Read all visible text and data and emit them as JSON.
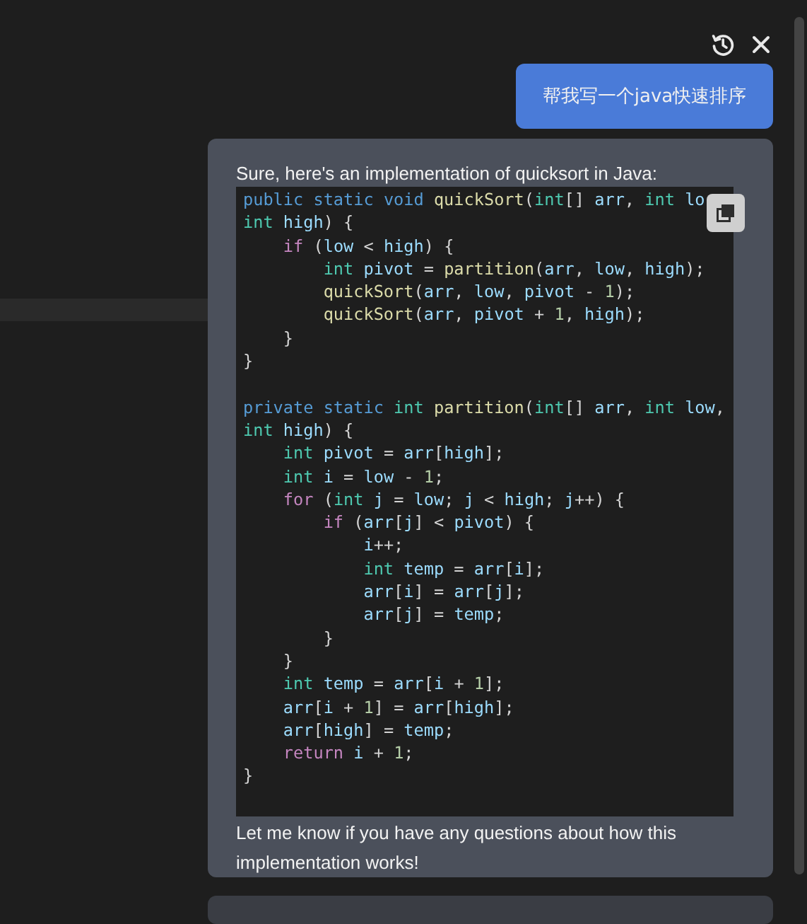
{
  "user_message": {
    "text": "帮我写一个java快速排序"
  },
  "reply": {
    "intro": "Sure, here's an implementation of quicksort in Java:",
    "code_methods": [
      {
        "lines": [
          {
            "tokens": [
              {
                "kind": "kw",
                "text": "public "
              },
              {
                "kind": "kw",
                "text": "static "
              },
              {
                "kind": "kw",
                "text": "void "
              },
              {
                "kind": "fn",
                "text": "quickSort"
              },
              {
                "kind": "p",
                "text": "("
              },
              {
                "kind": "type",
                "text": "int"
              },
              {
                "kind": "p",
                "text": "[] "
              },
              {
                "kind": "var",
                "text": "arr"
              },
              {
                "kind": "p",
                "text": ", "
              },
              {
                "kind": "type",
                "text": "int "
              },
              {
                "kind": "var",
                "text": "lo"
              }
            ]
          },
          {
            "tokens": [
              {
                "kind": "type",
                "text": "int "
              },
              {
                "kind": "var",
                "text": "high"
              },
              {
                "kind": "p",
                "text": ") {"
              }
            ]
          },
          {
            "tokens": [
              {
                "kind": "ctl",
                "text": "    if"
              },
              {
                "kind": "p",
                "text": " ("
              },
              {
                "kind": "var",
                "text": "low"
              },
              {
                "kind": "p",
                "text": " < "
              },
              {
                "kind": "var",
                "text": "high"
              },
              {
                "kind": "p",
                "text": ") {"
              }
            ]
          },
          {
            "tokens": [
              {
                "kind": "type",
                "text": "        int "
              },
              {
                "kind": "var",
                "text": "pivot"
              },
              {
                "kind": "p",
                "text": " = "
              },
              {
                "kind": "fn",
                "text": "partition"
              },
              {
                "kind": "p",
                "text": "("
              },
              {
                "kind": "var",
                "text": "arr"
              },
              {
                "kind": "p",
                "text": ", "
              },
              {
                "kind": "var",
                "text": "low"
              },
              {
                "kind": "p",
                "text": ", "
              },
              {
                "kind": "var",
                "text": "high"
              },
              {
                "kind": "p",
                "text": ");"
              }
            ]
          },
          {
            "tokens": [
              {
                "kind": "fn",
                "text": "        quickSort"
              },
              {
                "kind": "p",
                "text": "("
              },
              {
                "kind": "var",
                "text": "arr"
              },
              {
                "kind": "p",
                "text": ", "
              },
              {
                "kind": "var",
                "text": "low"
              },
              {
                "kind": "p",
                "text": ", "
              },
              {
                "kind": "var",
                "text": "pivot"
              },
              {
                "kind": "p",
                "text": " - "
              },
              {
                "kind": "num",
                "text": "1"
              },
              {
                "kind": "p",
                "text": ");"
              }
            ]
          },
          {
            "tokens": [
              {
                "kind": "fn",
                "text": "        quickSort"
              },
              {
                "kind": "p",
                "text": "("
              },
              {
                "kind": "var",
                "text": "arr"
              },
              {
                "kind": "p",
                "text": ", "
              },
              {
                "kind": "var",
                "text": "pivot"
              },
              {
                "kind": "p",
                "text": " + "
              },
              {
                "kind": "num",
                "text": "1"
              },
              {
                "kind": "p",
                "text": ", "
              },
              {
                "kind": "var",
                "text": "high"
              },
              {
                "kind": "p",
                "text": ");"
              }
            ]
          },
          {
            "tokens": [
              {
                "kind": "p",
                "text": "    }"
              }
            ]
          },
          {
            "tokens": [
              {
                "kind": "p",
                "text": "}"
              }
            ]
          }
        ]
      },
      {
        "lines": [
          {
            "tokens": [
              {
                "kind": "kw",
                "text": "private "
              },
              {
                "kind": "kw",
                "text": "static "
              },
              {
                "kind": "type",
                "text": "int "
              },
              {
                "kind": "fn",
                "text": "partition"
              },
              {
                "kind": "p",
                "text": "("
              },
              {
                "kind": "type",
                "text": "int"
              },
              {
                "kind": "p",
                "text": "[] "
              },
              {
                "kind": "var",
                "text": "arr"
              },
              {
                "kind": "p",
                "text": ", "
              },
              {
                "kind": "type",
                "text": "int "
              },
              {
                "kind": "var",
                "text": "low"
              },
              {
                "kind": "p",
                "text": ","
              }
            ]
          },
          {
            "tokens": [
              {
                "kind": "type",
                "text": "int "
              },
              {
                "kind": "var",
                "text": "high"
              },
              {
                "kind": "p",
                "text": ") {"
              }
            ]
          },
          {
            "tokens": [
              {
                "kind": "type",
                "text": "    int "
              },
              {
                "kind": "var",
                "text": "pivot"
              },
              {
                "kind": "p",
                "text": " = "
              },
              {
                "kind": "var",
                "text": "arr"
              },
              {
                "kind": "p",
                "text": "["
              },
              {
                "kind": "var",
                "text": "high"
              },
              {
                "kind": "p",
                "text": "];"
              }
            ]
          },
          {
            "tokens": [
              {
                "kind": "type",
                "text": "    int "
              },
              {
                "kind": "var",
                "text": "i"
              },
              {
                "kind": "p",
                "text": " = "
              },
              {
                "kind": "var",
                "text": "low"
              },
              {
                "kind": "p",
                "text": " - "
              },
              {
                "kind": "num",
                "text": "1"
              },
              {
                "kind": "p",
                "text": ";"
              }
            ]
          },
          {
            "tokens": [
              {
                "kind": "ctl",
                "text": "    for"
              },
              {
                "kind": "p",
                "text": " ("
              },
              {
                "kind": "type",
                "text": "int "
              },
              {
                "kind": "var",
                "text": "j"
              },
              {
                "kind": "p",
                "text": " = "
              },
              {
                "kind": "var",
                "text": "low"
              },
              {
                "kind": "p",
                "text": "; "
              },
              {
                "kind": "var",
                "text": "j"
              },
              {
                "kind": "p",
                "text": " < "
              },
              {
                "kind": "var",
                "text": "high"
              },
              {
                "kind": "p",
                "text": "; "
              },
              {
                "kind": "var",
                "text": "j"
              },
              {
                "kind": "p",
                "text": "++) {"
              }
            ]
          },
          {
            "tokens": [
              {
                "kind": "ctl",
                "text": "        if"
              },
              {
                "kind": "p",
                "text": " ("
              },
              {
                "kind": "var",
                "text": "arr"
              },
              {
                "kind": "p",
                "text": "["
              },
              {
                "kind": "var",
                "text": "j"
              },
              {
                "kind": "p",
                "text": "] < "
              },
              {
                "kind": "var",
                "text": "pivot"
              },
              {
                "kind": "p",
                "text": ") {"
              }
            ]
          },
          {
            "tokens": [
              {
                "kind": "var",
                "text": "            i"
              },
              {
                "kind": "p",
                "text": "++;"
              }
            ]
          },
          {
            "tokens": [
              {
                "kind": "type",
                "text": "            int "
              },
              {
                "kind": "var",
                "text": "temp"
              },
              {
                "kind": "p",
                "text": " = "
              },
              {
                "kind": "var",
                "text": "arr"
              },
              {
                "kind": "p",
                "text": "["
              },
              {
                "kind": "var",
                "text": "i"
              },
              {
                "kind": "p",
                "text": "];"
              }
            ]
          },
          {
            "tokens": [
              {
                "kind": "var",
                "text": "            arr"
              },
              {
                "kind": "p",
                "text": "["
              },
              {
                "kind": "var",
                "text": "i"
              },
              {
                "kind": "p",
                "text": "] = "
              },
              {
                "kind": "var",
                "text": "arr"
              },
              {
                "kind": "p",
                "text": "["
              },
              {
                "kind": "var",
                "text": "j"
              },
              {
                "kind": "p",
                "text": "];"
              }
            ]
          },
          {
            "tokens": [
              {
                "kind": "var",
                "text": "            arr"
              },
              {
                "kind": "p",
                "text": "["
              },
              {
                "kind": "var",
                "text": "j"
              },
              {
                "kind": "p",
                "text": "] = "
              },
              {
                "kind": "var",
                "text": "temp"
              },
              {
                "kind": "p",
                "text": ";"
              }
            ]
          },
          {
            "tokens": [
              {
                "kind": "p",
                "text": "        }"
              }
            ]
          },
          {
            "tokens": [
              {
                "kind": "p",
                "text": "    }"
              }
            ]
          },
          {
            "tokens": [
              {
                "kind": "type",
                "text": "    int "
              },
              {
                "kind": "var",
                "text": "temp"
              },
              {
                "kind": "p",
                "text": " = "
              },
              {
                "kind": "var",
                "text": "arr"
              },
              {
                "kind": "p",
                "text": "["
              },
              {
                "kind": "var",
                "text": "i"
              },
              {
                "kind": "p",
                "text": " + "
              },
              {
                "kind": "num",
                "text": "1"
              },
              {
                "kind": "p",
                "text": "];"
              }
            ]
          },
          {
            "tokens": [
              {
                "kind": "var",
                "text": "    arr"
              },
              {
                "kind": "p",
                "text": "["
              },
              {
                "kind": "var",
                "text": "i"
              },
              {
                "kind": "p",
                "text": " + "
              },
              {
                "kind": "num",
                "text": "1"
              },
              {
                "kind": "p",
                "text": "] = "
              },
              {
                "kind": "var",
                "text": "arr"
              },
              {
                "kind": "p",
                "text": "["
              },
              {
                "kind": "var",
                "text": "high"
              },
              {
                "kind": "p",
                "text": "];"
              }
            ]
          },
          {
            "tokens": [
              {
                "kind": "var",
                "text": "    arr"
              },
              {
                "kind": "p",
                "text": "["
              },
              {
                "kind": "var",
                "text": "high"
              },
              {
                "kind": "p",
                "text": "] = "
              },
              {
                "kind": "var",
                "text": "temp"
              },
              {
                "kind": "p",
                "text": ";"
              }
            ]
          },
          {
            "tokens": [
              {
                "kind": "ctl",
                "text": "    return "
              },
              {
                "kind": "var",
                "text": "i"
              },
              {
                "kind": "p",
                "text": " + "
              },
              {
                "kind": "num",
                "text": "1"
              },
              {
                "kind": "p",
                "text": ";"
              }
            ]
          },
          {
            "tokens": [
              {
                "kind": "p",
                "text": "}"
              }
            ]
          }
        ]
      }
    ],
    "outro": "Let me know if you have any questions about how this implementation works!"
  }
}
